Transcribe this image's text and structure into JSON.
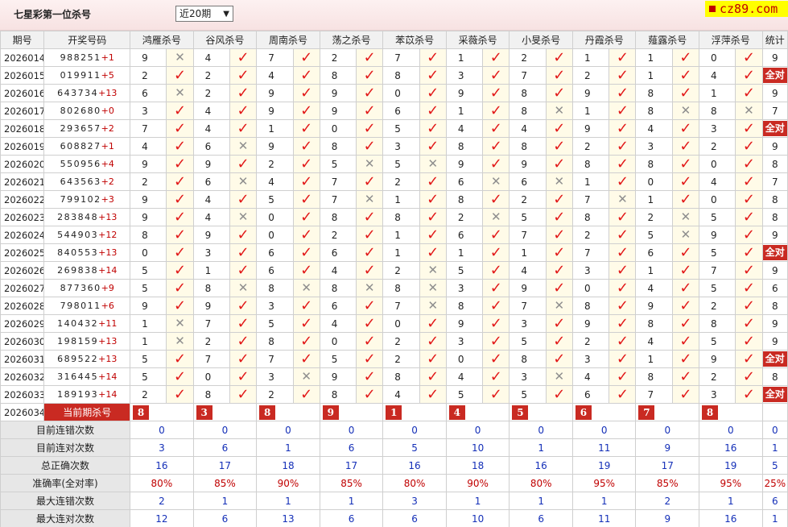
{
  "header": {
    "title": "七星彩第一位杀号",
    "select_value": "近20期",
    "logo_text": "cz89.com"
  },
  "columns": {
    "period": "期号",
    "draw": "开奖号码",
    "stats": "统计",
    "predictors": [
      "鸿雁杀号",
      "谷风杀号",
      "周南杀号",
      "荡之杀号",
      "苯苡杀号",
      "采薇杀号",
      "小旻杀号",
      "丹霞杀号",
      "薤露杀号",
      "浮萍杀号"
    ]
  },
  "rows": [
    {
      "period": "2026014",
      "digits": "988251",
      "sum": "+1",
      "picks": [
        [
          9,
          0
        ],
        [
          4,
          1
        ],
        [
          7,
          1
        ],
        [
          2,
          1
        ],
        [
          7,
          1
        ],
        [
          1,
          1
        ],
        [
          2,
          1
        ],
        [
          1,
          1
        ],
        [
          1,
          1
        ],
        [
          0,
          1
        ]
      ],
      "stat": "9"
    },
    {
      "period": "2026015",
      "digits": "019911",
      "sum": "+5",
      "picks": [
        [
          2,
          1
        ],
        [
          2,
          1
        ],
        [
          4,
          1
        ],
        [
          8,
          1
        ],
        [
          8,
          1
        ],
        [
          3,
          1
        ],
        [
          7,
          1
        ],
        [
          2,
          1
        ],
        [
          1,
          1
        ],
        [
          4,
          1
        ]
      ],
      "stat": "全对"
    },
    {
      "period": "2026016",
      "digits": "643734",
      "sum": "+13",
      "picks": [
        [
          6,
          0
        ],
        [
          2,
          1
        ],
        [
          9,
          1
        ],
        [
          9,
          1
        ],
        [
          0,
          1
        ],
        [
          9,
          1
        ],
        [
          8,
          1
        ],
        [
          9,
          1
        ],
        [
          8,
          1
        ],
        [
          1,
          1
        ]
      ],
      "stat": "9"
    },
    {
      "period": "2026017",
      "digits": "802680",
      "sum": "+0",
      "picks": [
        [
          3,
          1
        ],
        [
          4,
          1
        ],
        [
          9,
          1
        ],
        [
          9,
          1
        ],
        [
          6,
          1
        ],
        [
          1,
          1
        ],
        [
          8,
          0
        ],
        [
          1,
          1
        ],
        [
          8,
          0
        ],
        [
          8,
          0
        ]
      ],
      "stat": "7"
    },
    {
      "period": "2026018",
      "digits": "293657",
      "sum": "+2",
      "picks": [
        [
          7,
          1
        ],
        [
          4,
          1
        ],
        [
          1,
          1
        ],
        [
          0,
          1
        ],
        [
          5,
          1
        ],
        [
          4,
          1
        ],
        [
          4,
          1
        ],
        [
          9,
          1
        ],
        [
          4,
          1
        ],
        [
          3,
          1
        ]
      ],
      "stat": "全对"
    },
    {
      "period": "2026019",
      "digits": "608827",
      "sum": "+1",
      "picks": [
        [
          4,
          1
        ],
        [
          6,
          0
        ],
        [
          9,
          1
        ],
        [
          8,
          1
        ],
        [
          3,
          1
        ],
        [
          8,
          1
        ],
        [
          8,
          1
        ],
        [
          2,
          1
        ],
        [
          3,
          1
        ],
        [
          2,
          1
        ]
      ],
      "stat": "9"
    },
    {
      "period": "2026020",
      "digits": "550956",
      "sum": "+4",
      "picks": [
        [
          9,
          1
        ],
        [
          9,
          1
        ],
        [
          2,
          1
        ],
        [
          5,
          0
        ],
        [
          5,
          0
        ],
        [
          9,
          1
        ],
        [
          9,
          1
        ],
        [
          8,
          1
        ],
        [
          8,
          1
        ],
        [
          0,
          1
        ]
      ],
      "stat": "8"
    },
    {
      "period": "2026021",
      "digits": "643563",
      "sum": "+2",
      "picks": [
        [
          2,
          1
        ],
        [
          6,
          0
        ],
        [
          4,
          1
        ],
        [
          7,
          1
        ],
        [
          2,
          1
        ],
        [
          6,
          0
        ],
        [
          6,
          0
        ],
        [
          1,
          1
        ],
        [
          0,
          1
        ],
        [
          4,
          1
        ]
      ],
      "stat": "7"
    },
    {
      "period": "2026022",
      "digits": "799102",
      "sum": "+3",
      "picks": [
        [
          9,
          1
        ],
        [
          4,
          1
        ],
        [
          5,
          1
        ],
        [
          7,
          0
        ],
        [
          1,
          1
        ],
        [
          8,
          1
        ],
        [
          2,
          1
        ],
        [
          7,
          0
        ],
        [
          1,
          1
        ],
        [
          0,
          1
        ]
      ],
      "stat": "8"
    },
    {
      "period": "2026023",
      "digits": "283848",
      "sum": "+13",
      "picks": [
        [
          9,
          1
        ],
        [
          4,
          0
        ],
        [
          0,
          1
        ],
        [
          8,
          1
        ],
        [
          8,
          1
        ],
        [
          2,
          0
        ],
        [
          5,
          1
        ],
        [
          8,
          1
        ],
        [
          2,
          0
        ],
        [
          5,
          1
        ]
      ],
      "stat": "8"
    },
    {
      "period": "2026024",
      "digits": "544903",
      "sum": "+12",
      "picks": [
        [
          8,
          1
        ],
        [
          9,
          1
        ],
        [
          0,
          1
        ],
        [
          2,
          1
        ],
        [
          1,
          1
        ],
        [
          6,
          1
        ],
        [
          7,
          1
        ],
        [
          2,
          1
        ],
        [
          5,
          0
        ],
        [
          9,
          1
        ]
      ],
      "stat": "9"
    },
    {
      "period": "2026025",
      "digits": "840553",
      "sum": "+13",
      "picks": [
        [
          0,
          1
        ],
        [
          3,
          1
        ],
        [
          6,
          1
        ],
        [
          6,
          1
        ],
        [
          1,
          1
        ],
        [
          1,
          1
        ],
        [
          1,
          1
        ],
        [
          7,
          1
        ],
        [
          6,
          1
        ],
        [
          5,
          1
        ]
      ],
      "stat": "全对"
    },
    {
      "period": "2026026",
      "digits": "269838",
      "sum": "+14",
      "picks": [
        [
          5,
          1
        ],
        [
          1,
          1
        ],
        [
          6,
          1
        ],
        [
          4,
          1
        ],
        [
          2,
          0
        ],
        [
          5,
          1
        ],
        [
          4,
          1
        ],
        [
          3,
          1
        ],
        [
          1,
          1
        ],
        [
          7,
          1
        ]
      ],
      "stat": "9"
    },
    {
      "period": "2026027",
      "digits": "877360",
      "sum": "+9",
      "picks": [
        [
          5,
          1
        ],
        [
          8,
          0
        ],
        [
          8,
          0
        ],
        [
          8,
          0
        ],
        [
          8,
          0
        ],
        [
          3,
          1
        ],
        [
          9,
          1
        ],
        [
          0,
          1
        ],
        [
          4,
          1
        ],
        [
          5,
          1
        ]
      ],
      "stat": "6"
    },
    {
      "period": "2026028",
      "digits": "798011",
      "sum": "+6",
      "picks": [
        [
          9,
          1
        ],
        [
          9,
          1
        ],
        [
          3,
          1
        ],
        [
          6,
          1
        ],
        [
          7,
          0
        ],
        [
          8,
          1
        ],
        [
          7,
          0
        ],
        [
          8,
          1
        ],
        [
          9,
          1
        ],
        [
          2,
          1
        ]
      ],
      "stat": "8"
    },
    {
      "period": "2026029",
      "digits": "140432",
      "sum": "+11",
      "picks": [
        [
          1,
          0
        ],
        [
          7,
          1
        ],
        [
          5,
          1
        ],
        [
          4,
          1
        ],
        [
          0,
          1
        ],
        [
          9,
          1
        ],
        [
          3,
          1
        ],
        [
          9,
          1
        ],
        [
          8,
          1
        ],
        [
          8,
          1
        ]
      ],
      "stat": "9"
    },
    {
      "period": "2026030",
      "digits": "198159",
      "sum": "+13",
      "picks": [
        [
          1,
          0
        ],
        [
          2,
          1
        ],
        [
          8,
          1
        ],
        [
          0,
          1
        ],
        [
          2,
          1
        ],
        [
          3,
          1
        ],
        [
          5,
          1
        ],
        [
          2,
          1
        ],
        [
          4,
          1
        ],
        [
          5,
          1
        ]
      ],
      "stat": "9"
    },
    {
      "period": "2026031",
      "digits": "689522",
      "sum": "+13",
      "picks": [
        [
          5,
          1
        ],
        [
          7,
          1
        ],
        [
          7,
          1
        ],
        [
          5,
          1
        ],
        [
          2,
          1
        ],
        [
          0,
          1
        ],
        [
          8,
          1
        ],
        [
          3,
          1
        ],
        [
          1,
          1
        ],
        [
          9,
          1
        ]
      ],
      "stat": "全对"
    },
    {
      "period": "2026032",
      "digits": "316445",
      "sum": "+14",
      "picks": [
        [
          5,
          1
        ],
        [
          0,
          1
        ],
        [
          3,
          0
        ],
        [
          9,
          1
        ],
        [
          8,
          1
        ],
        [
          4,
          1
        ],
        [
          3,
          0
        ],
        [
          4,
          1
        ],
        [
          8,
          1
        ],
        [
          2,
          1
        ]
      ],
      "stat": "8"
    },
    {
      "period": "2026033",
      "digits": "189193",
      "sum": "+14",
      "picks": [
        [
          2,
          1
        ],
        [
          8,
          1
        ],
        [
          2,
          1
        ],
        [
          8,
          1
        ],
        [
          4,
          1
        ],
        [
          5,
          1
        ],
        [
          5,
          1
        ],
        [
          6,
          1
        ],
        [
          7,
          1
        ],
        [
          3,
          1
        ]
      ],
      "stat": "全对"
    }
  ],
  "current": {
    "period": "2026034",
    "label": "当前期杀号",
    "values": [
      "8",
      "3",
      "8",
      "9",
      "1",
      "4",
      "5",
      "6",
      "7",
      "8"
    ]
  },
  "stats": [
    {
      "label": "目前连错次数",
      "values": [
        "0",
        "0",
        "0",
        "0",
        "0",
        "0",
        "0",
        "0",
        "0",
        "0",
        "0"
      ]
    },
    {
      "label": "目前连对次数",
      "values": [
        "3",
        "6",
        "1",
        "6",
        "5",
        "10",
        "1",
        "11",
        "9",
        "16",
        "1"
      ]
    },
    {
      "label": "总正确次数",
      "values": [
        "16",
        "17",
        "18",
        "17",
        "16",
        "18",
        "16",
        "19",
        "17",
        "19",
        "5"
      ]
    },
    {
      "label": "准确率(全对率)",
      "values": [
        "80%",
        "85%",
        "90%",
        "85%",
        "80%",
        "90%",
        "80%",
        "95%",
        "85%",
        "95%",
        "25%"
      ],
      "accent": true
    },
    {
      "label": "最大连错次数",
      "values": [
        "2",
        "1",
        "1",
        "1",
        "3",
        "1",
        "1",
        "1",
        "2",
        "1",
        "6"
      ]
    },
    {
      "label": "最大连对次数",
      "values": [
        "12",
        "6",
        "13",
        "6",
        "6",
        "10",
        "6",
        "11",
        "9",
        "16",
        "1"
      ]
    }
  ],
  "icons": {
    "correct": "check-icon",
    "wrong": "cross-icon"
  },
  "colors": {
    "accent": "#c92a22",
    "stat_blue": "#1530b8",
    "highlight": "#fffbe8"
  }
}
